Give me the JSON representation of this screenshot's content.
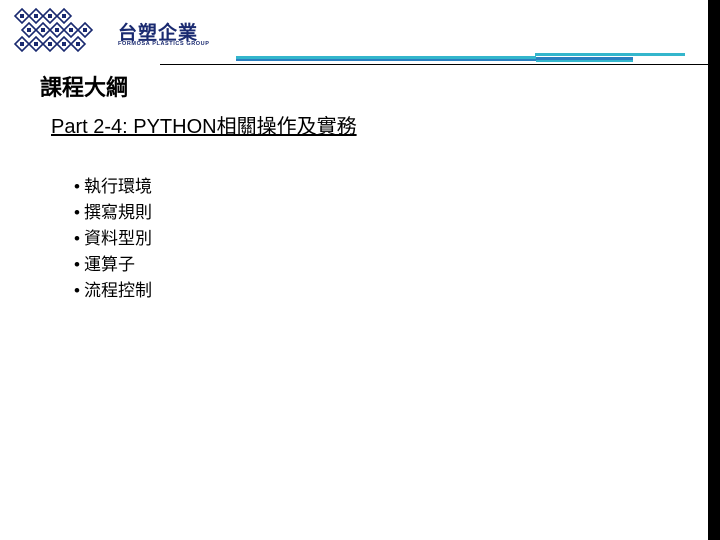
{
  "logo": {
    "name_cjk": "台塑企業",
    "name_en": "FORMOSA PLASTICS GROUP",
    "colors": {
      "primary": "#1a2a70",
      "accent": "#34b6cc"
    }
  },
  "slide": {
    "title": "課程大綱",
    "subtitle": "Part 2-4: PYTHON相關操作及實務",
    "bullet_symbol": "•",
    "items": [
      {
        "text": "執行環境"
      },
      {
        "text": "撰寫規則"
      },
      {
        "text": "資料型別"
      },
      {
        "text": "運算子"
      },
      {
        "text": "流程控制"
      }
    ]
  },
  "theme": {
    "header_line_cyan": "#34b6cc",
    "header_line_blue": "#2a7fc0",
    "side_bar": "#000000"
  }
}
